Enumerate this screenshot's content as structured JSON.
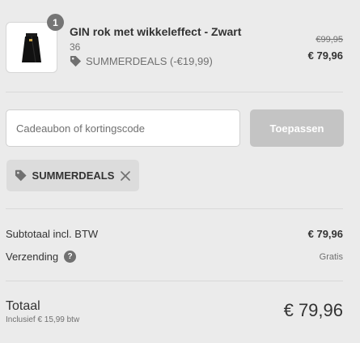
{
  "product": {
    "quantity": "1",
    "name": "GIN rok met wikkeleffect - Zwart",
    "size": "36",
    "discount_label": "SUMMERDEALS (-€19,99)",
    "old_price": "€99,95",
    "new_price": "€ 79,96"
  },
  "promo": {
    "input_value": "",
    "input_placeholder": "Cadeaubon of kortingscode",
    "apply_label": "Toepassen",
    "applied_code": "SUMMERDEALS"
  },
  "summary": {
    "subtotal_label": "Subtotaal incl. BTW",
    "subtotal_value": "€ 79,96",
    "shipping_label": "Verzending",
    "shipping_help": "?",
    "shipping_value": "Gratis",
    "total_label": "Totaal",
    "vat_note": "Inclusief € 15,99 btw",
    "total_value": "€ 79,96"
  },
  "icons": {
    "tag": "tag-icon",
    "remove": "close-icon",
    "help": "question-circle-icon"
  },
  "colors": {
    "background": "#ebebeb",
    "apply_button_disabled": "#c4c4c4",
    "chip_background": "#dcdcdc",
    "muted_text": "#707070"
  }
}
